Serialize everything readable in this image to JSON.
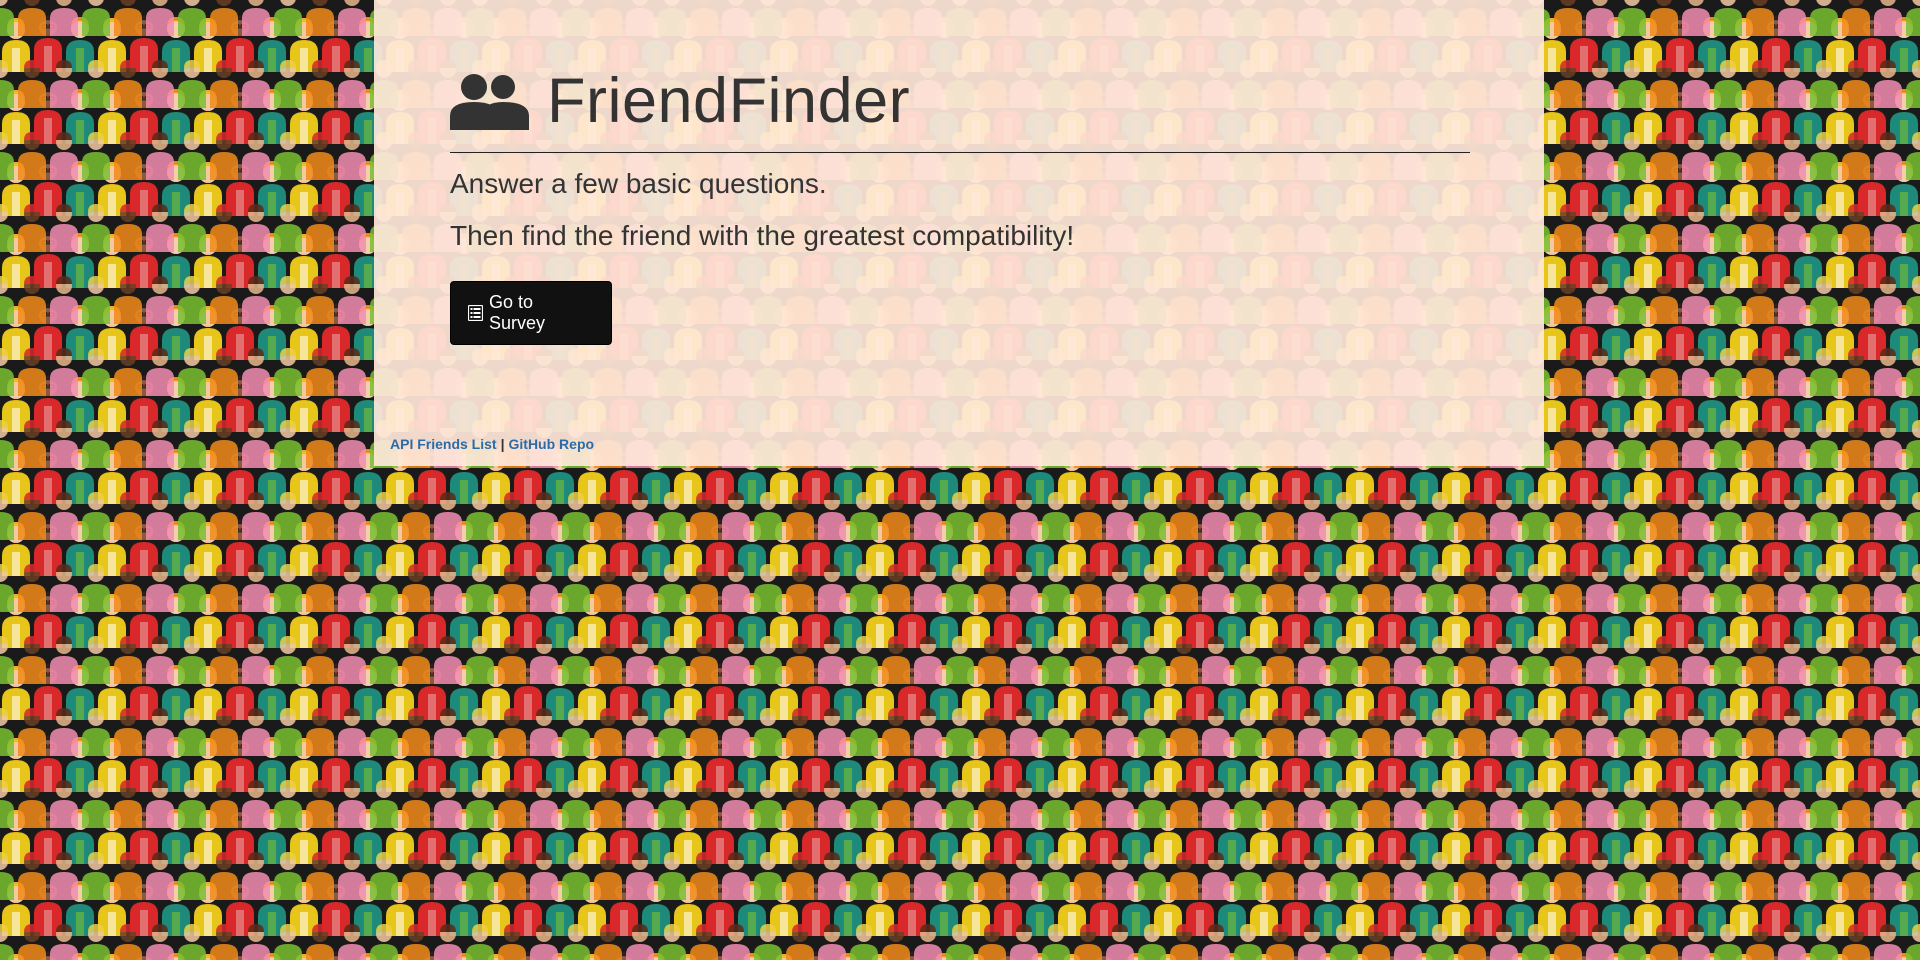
{
  "page": {
    "background": "crowd-illustration",
    "panel_color": "#ffe8da"
  },
  "header": {
    "icon": "users-icon",
    "title": "FriendFinder"
  },
  "main": {
    "lead_line_1": "Answer a few basic questions.",
    "lead_line_2": "Then find the friend with the greatest compatibility!",
    "survey_button": {
      "icon": "list-alt-icon",
      "label": "Go to Survey"
    }
  },
  "footer": {
    "api_link": "API Friends List",
    "separator": "|",
    "github_link": "GitHub Repo",
    "link_color": "#2a6ca8"
  }
}
